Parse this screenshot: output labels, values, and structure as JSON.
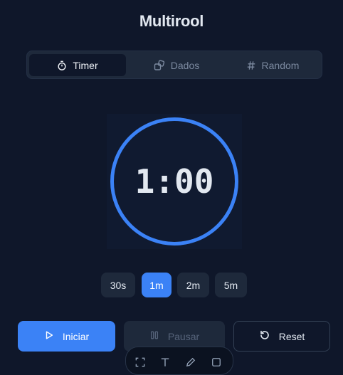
{
  "app": {
    "title": "Multirool"
  },
  "tabs": [
    {
      "label": "Timer",
      "icon": "stopwatch-icon",
      "active": true
    },
    {
      "label": "Dados",
      "icon": "dice-icon",
      "active": false
    },
    {
      "label": "Random",
      "icon": "hash-icon",
      "active": false
    }
  ],
  "timer": {
    "display": "1:00",
    "progress": 1.0
  },
  "presets": [
    {
      "label": "30s",
      "active": false
    },
    {
      "label": "1m",
      "active": true
    },
    {
      "label": "2m",
      "active": false
    },
    {
      "label": "5m",
      "active": false
    }
  ],
  "controls": {
    "start_label": "Iniciar",
    "pause_label": "Pausar",
    "reset_label": "Reset"
  },
  "toolbar": {
    "icons": [
      "screenshot-select-icon",
      "text-icon",
      "pen-icon",
      "rectangle-icon"
    ]
  },
  "colors": {
    "background": "#0f172a",
    "accent": "#3b82f6",
    "panel": "#1e293b",
    "muted": "#7c8aa0"
  }
}
